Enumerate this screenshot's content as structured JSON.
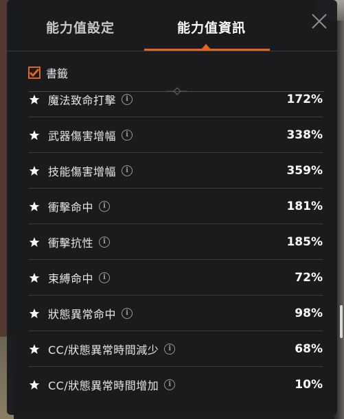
{
  "tabs": [
    {
      "label": "能力值設定",
      "active": false
    },
    {
      "label": "能力值資訊",
      "active": true
    }
  ],
  "bookmark": {
    "label": "書籤",
    "checked": true
  },
  "stats": [
    {
      "label": "魔法致命打擊",
      "value": "172%"
    },
    {
      "label": "武器傷害增幅",
      "value": "338%"
    },
    {
      "label": "技能傷害增幅",
      "value": "359%"
    },
    {
      "label": "衝擊命中",
      "value": "181%"
    },
    {
      "label": "衝擊抗性",
      "value": "185%"
    },
    {
      "label": "束縛命中",
      "value": "72%"
    },
    {
      "label": "狀態異常命中",
      "value": "98%"
    },
    {
      "label": "CC/狀態異常時間減少",
      "value": "68%"
    },
    {
      "label": "CC/狀態異常時間增加",
      "value": "10%"
    }
  ],
  "colors": {
    "accent": "#e2651d",
    "panel": "#1a1b1e"
  },
  "icons": {
    "close": "close-icon",
    "star": "star-icon",
    "info": "info-icon",
    "check": "checkmark-icon"
  }
}
